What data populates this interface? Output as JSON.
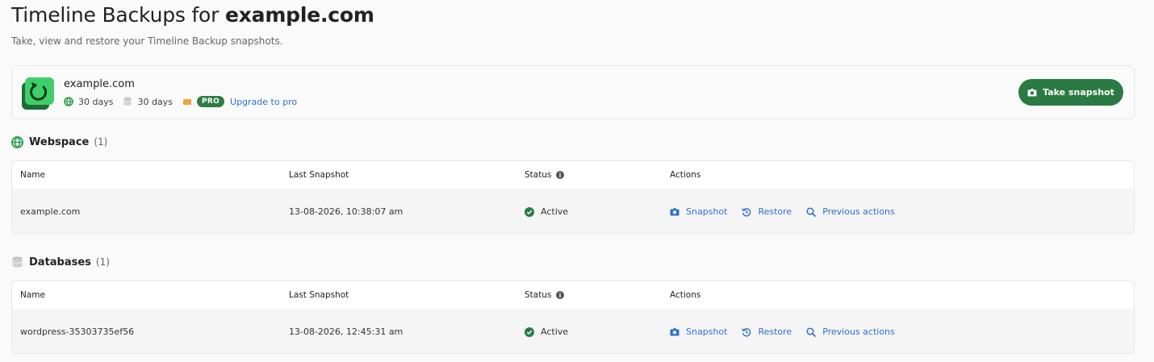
{
  "header": {
    "title_prefix": "Timeline Backups for ",
    "title_domain": "example.com",
    "subtitle": "Take, view and restore your Timeline Backup snapshots."
  },
  "summary_card": {
    "site_name": "example.com",
    "webspace_retention": "30 days",
    "database_retention": "30 days",
    "pro_badge": "PRO",
    "upgrade_link": "Upgrade to pro",
    "take_snapshot_label": "Take snapshot"
  },
  "columns": {
    "name": "Name",
    "last_snapshot": "Last Snapshot",
    "status": "Status",
    "actions": "Actions"
  },
  "actions": {
    "snapshot": "Snapshot",
    "restore": "Restore",
    "previous": "Previous actions"
  },
  "webspace": {
    "title": "Webspace",
    "count": "(1)",
    "rows": [
      {
        "name": "example.com",
        "last_snapshot": "13-08-2026, 10:38:07 am",
        "status": "Active"
      }
    ]
  },
  "databases": {
    "title": "Databases",
    "count": "(1)",
    "rows": [
      {
        "name": "wordpress-35303735ef56",
        "last_snapshot": "13-08-2026, 12:45:31 am",
        "status": "Active"
      }
    ]
  },
  "colors": {
    "accent_green": "#2a7a44",
    "link_blue": "#2f6fd6",
    "pro_green": "#2e7d43"
  }
}
